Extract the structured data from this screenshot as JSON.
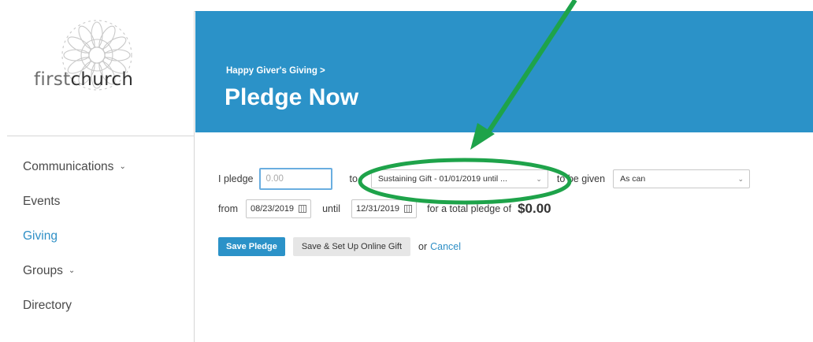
{
  "logo": {
    "text_light": "first",
    "text_bold": "church"
  },
  "sidebar": {
    "items": [
      {
        "label": "Communications",
        "has_chevron": true
      },
      {
        "label": "Events",
        "has_chevron": false
      },
      {
        "label": "Giving",
        "has_chevron": false,
        "active": true
      },
      {
        "label": "Groups",
        "has_chevron": true
      },
      {
        "label": "Directory",
        "has_chevron": false
      }
    ],
    "chevron": "⌄"
  },
  "header": {
    "breadcrumb": "Happy Giver's Giving >",
    "title": "Pledge Now",
    "background": "#2b92c8"
  },
  "form": {
    "pledge_label": "I pledge",
    "amount_placeholder": "0.00",
    "to_label": "to",
    "fund_value": "Sustaining Gift - 01/01/2019 until ...",
    "to_be_given_label": "to be given",
    "frequency_value": "As can",
    "from_label": "from",
    "start_date": "08/23/2019",
    "until_label": "until",
    "end_date": "12/31/2019",
    "total_label": "for a total pledge of",
    "total_value": "$0.00"
  },
  "actions": {
    "save_label": "Save Pledge",
    "save_online_label": "Save & Set Up Online Gift",
    "or_label": "or",
    "cancel_label": "Cancel"
  },
  "annotation": {
    "color": "#1ea34a",
    "arrow-icon": "arrow-icon"
  },
  "colors": {
    "accent": "#2b92c8",
    "link": "#2e8fc6"
  }
}
